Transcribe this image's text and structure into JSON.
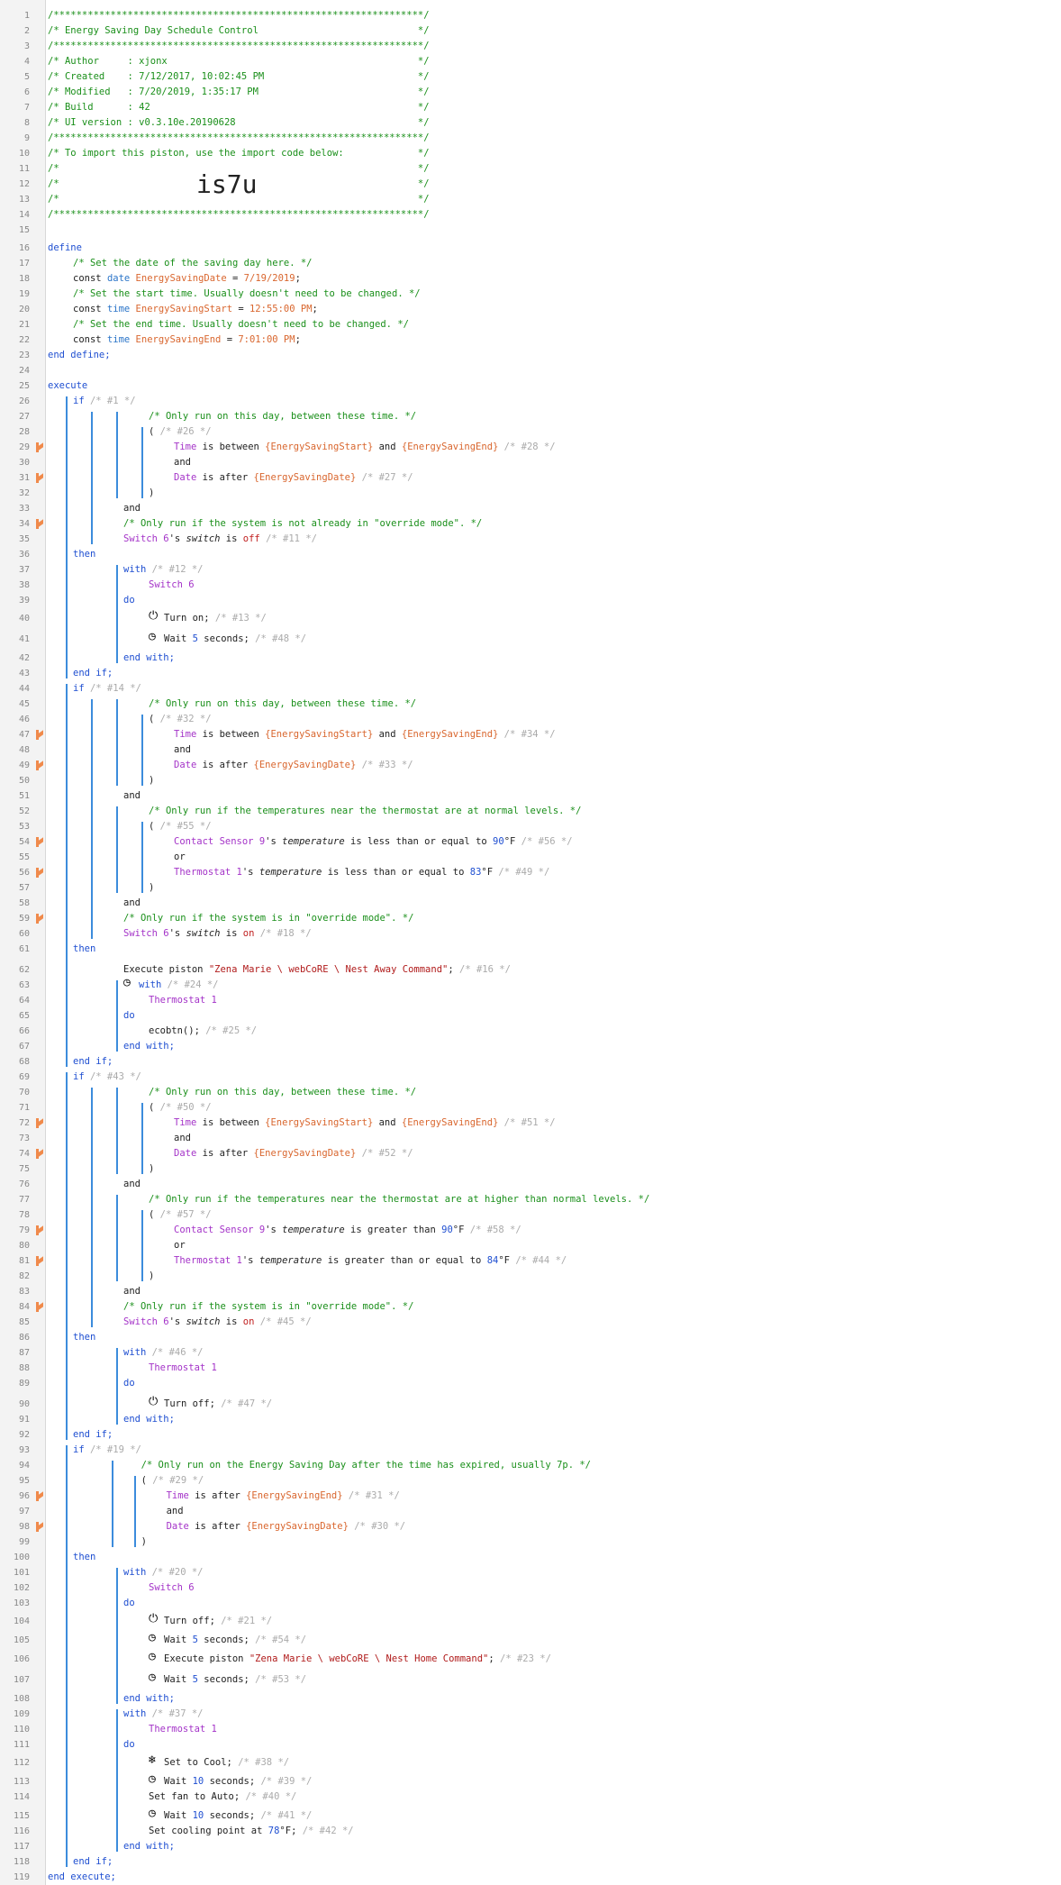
{
  "big_code": "is7u",
  "lines": [
    [
      [
        "comment",
        "/*****************************************************************/"
      ]
    ],
    [
      [
        "comment",
        "/* Energy Saving Day Schedule Control                            */"
      ]
    ],
    [
      [
        "comment",
        "/*****************************************************************/"
      ]
    ],
    [
      [
        "comment",
        "/* Author     : xjonx                                            */"
      ]
    ],
    [
      [
        "comment",
        "/* Created    : 7/12/2017, 10:02:45 PM                           */"
      ]
    ],
    [
      [
        "comment",
        "/* Modified   : 7/20/2019, 1:35:17 PM                            */"
      ]
    ],
    [
      [
        "comment",
        "/* Build      : 42                                               */"
      ]
    ],
    [
      [
        "comment",
        "/* UI version : v0.3.10e.20190628                                */"
      ]
    ],
    [
      [
        "comment",
        "/*****************************************************************/"
      ]
    ],
    [
      [
        "comment",
        "/* To import this piston, use the import code below:             */"
      ]
    ],
    [
      [
        "comment",
        "/*                                                               */"
      ]
    ],
    [
      [
        "comment",
        "/*                                                               */"
      ]
    ],
    [
      [
        "comment",
        "/*                                                               */"
      ]
    ],
    [
      [
        "comment",
        "/*****************************************************************/"
      ]
    ],
    [],
    [
      [
        "keyword",
        "define"
      ]
    ],
    [
      [
        "comment",
        "/* Set the date of the saving day here. */"
      ]
    ],
    [
      [
        "plain",
        "const "
      ],
      [
        "type",
        "date "
      ],
      [
        "var",
        "EnergySavingDate"
      ],
      [
        "plain",
        " = "
      ],
      [
        "var",
        "7/19/2019"
      ],
      [
        "plain",
        ";"
      ]
    ],
    [
      [
        "comment",
        "/* Set the start time. Usually doesn't need to be changed. */"
      ]
    ],
    [
      [
        "plain",
        "const "
      ],
      [
        "type",
        "time "
      ],
      [
        "var",
        "EnergySavingStart"
      ],
      [
        "plain",
        " = "
      ],
      [
        "var",
        "12:55:00 PM"
      ],
      [
        "plain",
        ";"
      ]
    ],
    [
      [
        "comment",
        "/* Set the end time. Usually doesn't need to be changed. */"
      ]
    ],
    [
      [
        "plain",
        "const "
      ],
      [
        "type",
        "time "
      ],
      [
        "var",
        "EnergySavingEnd"
      ],
      [
        "plain",
        " = "
      ],
      [
        "var",
        "7:01:00 PM"
      ],
      [
        "plain",
        ";"
      ]
    ],
    [
      [
        "keyword",
        "end define;"
      ]
    ],
    [],
    [
      [
        "keyword",
        "execute"
      ]
    ],
    [
      [
        "keyword",
        "if "
      ],
      [
        "dim",
        "/* #1 */"
      ]
    ],
    [
      [
        "comment",
        "/* Only run on this day, between these time. */"
      ]
    ],
    [
      [
        "plain",
        "( "
      ],
      [
        "dim",
        "/* #26 */"
      ]
    ],
    [
      [
        "device",
        "Time"
      ],
      [
        "plain",
        " is between "
      ],
      [
        "var",
        "{EnergySavingStart}"
      ],
      [
        "plain",
        " and "
      ],
      [
        "var",
        "{EnergySavingEnd}"
      ],
      [
        "dim",
        " /* #28 */"
      ]
    ],
    [
      [
        "plain",
        "and"
      ]
    ],
    [
      [
        "device",
        "Date"
      ],
      [
        "plain",
        " is after "
      ],
      [
        "var",
        "{EnergySavingDate}"
      ],
      [
        "dim",
        " /* #27 */"
      ]
    ],
    [
      [
        "plain",
        ")"
      ]
    ],
    [
      [
        "plain",
        "and"
      ]
    ],
    [
      [
        "comment",
        "/* Only run if the system is not already in \"override mode\". */"
      ]
    ],
    [
      [
        "device",
        "Switch 6"
      ],
      [
        "plain",
        "'s "
      ],
      [
        "attr",
        "switch"
      ],
      [
        "plain",
        " is "
      ],
      [
        "off",
        "off"
      ],
      [
        "dim",
        " /* #11 */"
      ]
    ],
    [
      [
        "keyword",
        "then"
      ]
    ],
    [
      [
        "keyword",
        "with "
      ],
      [
        "dim",
        "/* #12 */"
      ]
    ],
    [
      [
        "device",
        "Switch 6"
      ]
    ],
    [
      [
        "keyword",
        "do"
      ]
    ],
    [
      [
        "plain",
        "Turn on; "
      ],
      [
        "dim",
        "/* #13 */"
      ]
    ],
    [
      [
        "plain",
        "Wait "
      ],
      [
        "value",
        "5"
      ],
      [
        "plain",
        " seconds; "
      ],
      [
        "dim",
        "/* #48 */"
      ]
    ],
    [
      [
        "keyword",
        "end with;"
      ]
    ],
    [
      [
        "keyword",
        "end if;"
      ]
    ],
    [
      [
        "keyword",
        "if "
      ],
      [
        "dim",
        "/* #14 */"
      ]
    ],
    [
      [
        "comment",
        "/* Only run on this day, between these time. */"
      ]
    ],
    [
      [
        "plain",
        "( "
      ],
      [
        "dim",
        "/* #32 */"
      ]
    ],
    [
      [
        "device",
        "Time"
      ],
      [
        "plain",
        " is between "
      ],
      [
        "var",
        "{EnergySavingStart}"
      ],
      [
        "plain",
        " and "
      ],
      [
        "var",
        "{EnergySavingEnd}"
      ],
      [
        "dim",
        " /* #34 */"
      ]
    ],
    [
      [
        "plain",
        "and"
      ]
    ],
    [
      [
        "device",
        "Date"
      ],
      [
        "plain",
        " is after "
      ],
      [
        "var",
        "{EnergySavingDate}"
      ],
      [
        "dim",
        " /* #33 */"
      ]
    ],
    [
      [
        "plain",
        ")"
      ]
    ],
    [
      [
        "plain",
        "and"
      ]
    ],
    [
      [
        "comment",
        "/* Only run if the temperatures near the thermostat are at normal levels. */"
      ]
    ],
    [
      [
        "plain",
        "( "
      ],
      [
        "dim",
        "/* #55 */"
      ]
    ],
    [
      [
        "device",
        "Contact Sensor 9"
      ],
      [
        "plain",
        "'s "
      ],
      [
        "attr",
        "temperature"
      ],
      [
        "plain",
        " is less than or equal to "
      ],
      [
        "value",
        "90"
      ],
      [
        "plain",
        "°F "
      ],
      [
        "dim",
        "/* #56 */"
      ]
    ],
    [
      [
        "plain",
        "or"
      ]
    ],
    [
      [
        "device",
        "Thermostat 1"
      ],
      [
        "plain",
        "'s "
      ],
      [
        "attr",
        "temperature"
      ],
      [
        "plain",
        " is less than or equal to "
      ],
      [
        "value",
        "83"
      ],
      [
        "plain",
        "°F "
      ],
      [
        "dim",
        "/* #49 */"
      ]
    ],
    [
      [
        "plain",
        ")"
      ]
    ],
    [
      [
        "plain",
        "and"
      ]
    ],
    [
      [
        "comment",
        "/* Only run if the system is in \"override mode\". */"
      ]
    ],
    [
      [
        "device",
        "Switch 6"
      ],
      [
        "plain",
        "'s "
      ],
      [
        "attr",
        "switch"
      ],
      [
        "plain",
        " is "
      ],
      [
        "off",
        "on"
      ],
      [
        "dim",
        " /* #18 */"
      ]
    ],
    [
      [
        "keyword",
        "then"
      ]
    ],
    [
      [
        "plain",
        "Execute piston "
      ],
      [
        "string",
        "\"Zena Marie \\ webCoRE \\ Nest Away Command\""
      ],
      [
        "plain",
        "; "
      ],
      [
        "dim",
        "/* #16 */"
      ]
    ],
    [
      [
        "keyword",
        "with "
      ],
      [
        "dim",
        "/* #24 */"
      ]
    ],
    [
      [
        "device",
        "Thermostat 1"
      ]
    ],
    [
      [
        "keyword",
        "do"
      ]
    ],
    [
      [
        "plain",
        "ecobtn(); "
      ],
      [
        "dim",
        "/* #25 */"
      ]
    ],
    [
      [
        "keyword",
        "end with;"
      ]
    ],
    [
      [
        "keyword",
        "end if;"
      ]
    ],
    [
      [
        "keyword",
        "if "
      ],
      [
        "dim",
        "/* #43 */"
      ]
    ],
    [
      [
        "comment",
        "/* Only run on this day, between these time. */"
      ]
    ],
    [
      [
        "plain",
        "( "
      ],
      [
        "dim",
        "/* #50 */"
      ]
    ],
    [
      [
        "device",
        "Time"
      ],
      [
        "plain",
        " is between "
      ],
      [
        "var",
        "{EnergySavingStart}"
      ],
      [
        "plain",
        " and "
      ],
      [
        "var",
        "{EnergySavingEnd}"
      ],
      [
        "dim",
        " /* #51 */"
      ]
    ],
    [
      [
        "plain",
        "and"
      ]
    ],
    [
      [
        "device",
        "Date"
      ],
      [
        "plain",
        " is after "
      ],
      [
        "var",
        "{EnergySavingDate}"
      ],
      [
        "dim",
        " /* #52 */"
      ]
    ],
    [
      [
        "plain",
        ")"
      ]
    ],
    [
      [
        "plain",
        "and"
      ]
    ],
    [
      [
        "comment",
        "/* Only run if the temperatures near the thermostat are at higher than normal levels. */"
      ]
    ],
    [
      [
        "plain",
        "( "
      ],
      [
        "dim",
        "/* #57 */"
      ]
    ],
    [
      [
        "device",
        "Contact Sensor 9"
      ],
      [
        "plain",
        "'s "
      ],
      [
        "attr",
        "temperature"
      ],
      [
        "plain",
        " is greater than "
      ],
      [
        "value",
        "90"
      ],
      [
        "plain",
        "°F "
      ],
      [
        "dim",
        "/* #58 */"
      ]
    ],
    [
      [
        "plain",
        "or"
      ]
    ],
    [
      [
        "device",
        "Thermostat 1"
      ],
      [
        "plain",
        "'s "
      ],
      [
        "attr",
        "temperature"
      ],
      [
        "plain",
        " is greater than or equal to "
      ],
      [
        "value",
        "84"
      ],
      [
        "plain",
        "°F "
      ],
      [
        "dim",
        "/* #44 */"
      ]
    ],
    [
      [
        "plain",
        ")"
      ]
    ],
    [
      [
        "plain",
        "and"
      ]
    ],
    [
      [
        "comment",
        "/* Only run if the system is in \"override mode\". */"
      ]
    ],
    [
      [
        "device",
        "Switch 6"
      ],
      [
        "plain",
        "'s "
      ],
      [
        "attr",
        "switch"
      ],
      [
        "plain",
        " is "
      ],
      [
        "off",
        "on"
      ],
      [
        "dim",
        " /* #45 */"
      ]
    ],
    [
      [
        "keyword",
        "then"
      ]
    ],
    [
      [
        "keyword",
        "with "
      ],
      [
        "dim",
        "/* #46 */"
      ]
    ],
    [
      [
        "device",
        "Thermostat 1"
      ]
    ],
    [
      [
        "keyword",
        "do"
      ]
    ],
    [
      [
        "plain",
        "Turn off; "
      ],
      [
        "dim",
        "/* #47 */"
      ]
    ],
    [
      [
        "keyword",
        "end with;"
      ]
    ],
    [
      [
        "keyword",
        "end if;"
      ]
    ],
    [
      [
        "keyword",
        "if "
      ],
      [
        "dim",
        "/* #19 */"
      ]
    ],
    [
      [
        "comment",
        "/* Only run on the Energy Saving Day after the time has expired, usually 7p. */"
      ]
    ],
    [
      [
        "plain",
        "( "
      ],
      [
        "dim",
        "/* #29 */"
      ]
    ],
    [
      [
        "device",
        "Time"
      ],
      [
        "plain",
        " is after "
      ],
      [
        "var",
        "{EnergySavingEnd}"
      ],
      [
        "dim",
        " /* #31 */"
      ]
    ],
    [
      [
        "plain",
        "and"
      ]
    ],
    [
      [
        "device",
        "Date"
      ],
      [
        "plain",
        " is after "
      ],
      [
        "var",
        "{EnergySavingDate}"
      ],
      [
        "dim",
        " /* #30 */"
      ]
    ],
    [
      [
        "plain",
        ")"
      ]
    ],
    [
      [
        "keyword",
        "then"
      ]
    ],
    [
      [
        "keyword",
        "with "
      ],
      [
        "dim",
        "/* #20 */"
      ]
    ],
    [
      [
        "device",
        "Switch 6"
      ]
    ],
    [
      [
        "keyword",
        "do"
      ]
    ],
    [
      [
        "plain",
        "Turn off; "
      ],
      [
        "dim",
        "/* #21 */"
      ]
    ],
    [
      [
        "plain",
        "Wait "
      ],
      [
        "value",
        "5"
      ],
      [
        "plain",
        " seconds; "
      ],
      [
        "dim",
        "/* #54 */"
      ]
    ],
    [
      [
        "plain",
        "Execute piston "
      ],
      [
        "string",
        "\"Zena Marie \\ webCoRE \\ Nest Home Command\""
      ],
      [
        "plain",
        "; "
      ],
      [
        "dim",
        "/* #23 */"
      ]
    ],
    [
      [
        "plain",
        "Wait "
      ],
      [
        "value",
        "5"
      ],
      [
        "plain",
        " seconds; "
      ],
      [
        "dim",
        "/* #53 */"
      ]
    ],
    [
      [
        "keyword",
        "end with;"
      ]
    ],
    [
      [
        "keyword",
        "with "
      ],
      [
        "dim",
        "/* #37 */"
      ]
    ],
    [
      [
        "device",
        "Thermostat 1"
      ]
    ],
    [
      [
        "keyword",
        "do"
      ]
    ],
    [
      [
        "plain",
        "Set to Cool; "
      ],
      [
        "dim",
        "/* #38 */"
      ]
    ],
    [
      [
        "plain",
        "Wait "
      ],
      [
        "value",
        "10"
      ],
      [
        "plain",
        " seconds; "
      ],
      [
        "dim",
        "/* #39 */"
      ]
    ],
    [
      [
        "plain",
        "Set fan to Auto; "
      ],
      [
        "dim",
        "/* #40 */"
      ]
    ],
    [
      [
        "plain",
        "Wait "
      ],
      [
        "value",
        "10"
      ],
      [
        "plain",
        " seconds; "
      ],
      [
        "dim",
        "/* #41 */"
      ]
    ],
    [
      [
        "plain",
        "Set cooling point at "
      ],
      [
        "value",
        "78"
      ],
      [
        "plain",
        "°F; "
      ],
      [
        "dim",
        "/* #42 */"
      ]
    ],
    [
      [
        "keyword",
        "end with;"
      ]
    ],
    [
      [
        "keyword",
        "end if;"
      ]
    ],
    [
      [
        "keyword",
        "end execute;"
      ]
    ]
  ],
  "line_icons": {
    "40": "power-icon",
    "41": "clock-icon",
    "63": "clock-icon",
    "90": "power-icon",
    "104": "power-icon",
    "105": "clock-icon",
    "106": "clock-icon",
    "107": "clock-icon",
    "112": "snowflake-icon",
    "113": "clock-icon",
    "115": "clock-icon"
  },
  "flag_lines": [
    29,
    31,
    34,
    47,
    49,
    54,
    56,
    59,
    72,
    74,
    79,
    81,
    84,
    96,
    98
  ],
  "colors": {
    "comment": "#1a8f1a",
    "keyword": "#1f4fd1",
    "variable": "#d9662e",
    "device": "#a433c8",
    "string": "#b01a1a",
    "flag": "#f08a4b",
    "bracket": "#3c8cdc"
  }
}
